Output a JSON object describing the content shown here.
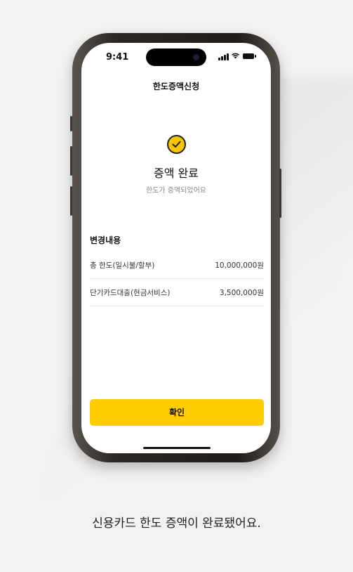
{
  "status_bar": {
    "time": "9:41"
  },
  "header": {
    "title": "한도증액신청"
  },
  "result": {
    "title": "증액 완료",
    "subtitle": "한도가 증액되었어요"
  },
  "changes": {
    "title": "변경내용",
    "rows": [
      {
        "label": "총 한도(일시불/할부)",
        "value": "10,000,000원"
      },
      {
        "label": "단기카드대출(현금서비스)",
        "value": "3,500,000원"
      }
    ]
  },
  "confirm_button": {
    "label": "확인"
  },
  "caption": "신용카드 한도 증액이 완료됐어요.",
  "colors": {
    "accent": "#ffcc00",
    "background": "#f2f2f2"
  },
  "icons": {
    "check": "check-circle-icon",
    "signal": "signal-icon",
    "wifi": "wifi-icon",
    "battery": "battery-icon"
  }
}
